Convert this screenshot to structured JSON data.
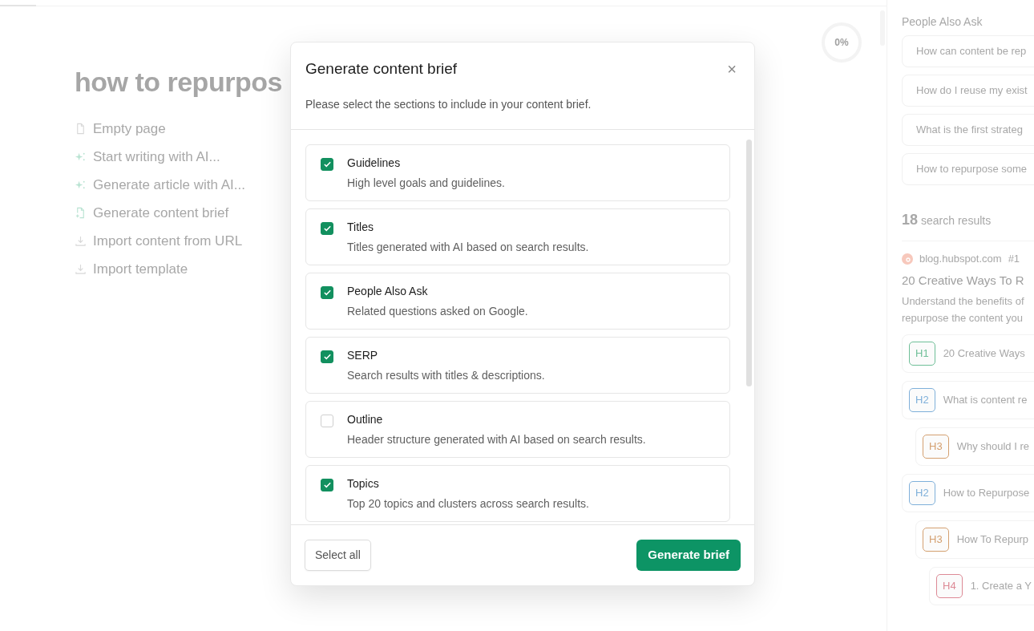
{
  "editor": {
    "progress": "0%",
    "title": "how to repurpos",
    "actions": [
      {
        "kind": "page",
        "label": "Empty page"
      },
      {
        "kind": "ai",
        "label": "Start writing with AI..."
      },
      {
        "kind": "ai",
        "label": "Generate article with AI..."
      },
      {
        "kind": "brief",
        "label": "Generate content brief"
      },
      {
        "kind": "import",
        "label": "Import content from URL"
      },
      {
        "kind": "import",
        "label": "Import template"
      }
    ]
  },
  "sidebar": {
    "paa_title": "People Also Ask",
    "questions": [
      "How can content be rep",
      "How do I reuse my exist",
      "What is the first strateg",
      "How to repurpose some"
    ],
    "results_count": "18",
    "results_label": "search results",
    "result": {
      "domain": "blog.hubspot.com",
      "rank": "#1",
      "title": "20 Creative Ways To R",
      "snippet": [
        "Understand the benefits of",
        "repurpose the content you"
      ]
    },
    "headings": [
      {
        "tag": "H1",
        "color": "#6fbf98",
        "text": "20 Creative Ways"
      },
      {
        "tag": "H2",
        "color": "#7fb0da",
        "text": "What is content re",
        "children": [
          {
            "tag": "H3",
            "color": "#d4a070",
            "text": "Why should I re"
          }
        ]
      },
      {
        "tag": "H2",
        "color": "#7fb0da",
        "text": "How to Repurpose",
        "children": [
          {
            "tag": "H3",
            "color": "#d4a070",
            "text": "How To Repurp",
            "children": [
              {
                "tag": "H4",
                "color": "#dd8a96",
                "text": "1. Create a Y"
              }
            ]
          }
        ]
      }
    ]
  },
  "modal": {
    "title": "Generate content brief",
    "subtitle": "Please select the sections to include in your content brief.",
    "close": "×",
    "sections": [
      {
        "label": "Guidelines",
        "description": "High level goals and guidelines.",
        "checked": true
      },
      {
        "label": "Titles",
        "description": "Titles generated with AI based on search results.",
        "checked": true
      },
      {
        "label": "People Also Ask",
        "description": "Related questions asked on Google.",
        "checked": true
      },
      {
        "label": "SERP",
        "description": "Search results with titles & descriptions.",
        "checked": true
      },
      {
        "label": "Outline",
        "description": "Header structure generated with AI based on search results.",
        "checked": false
      },
      {
        "label": "Topics",
        "description": "Top 20 topics and clusters across search results.",
        "checked": true
      }
    ],
    "select_all": "Select all",
    "generate": "Generate brief"
  }
}
